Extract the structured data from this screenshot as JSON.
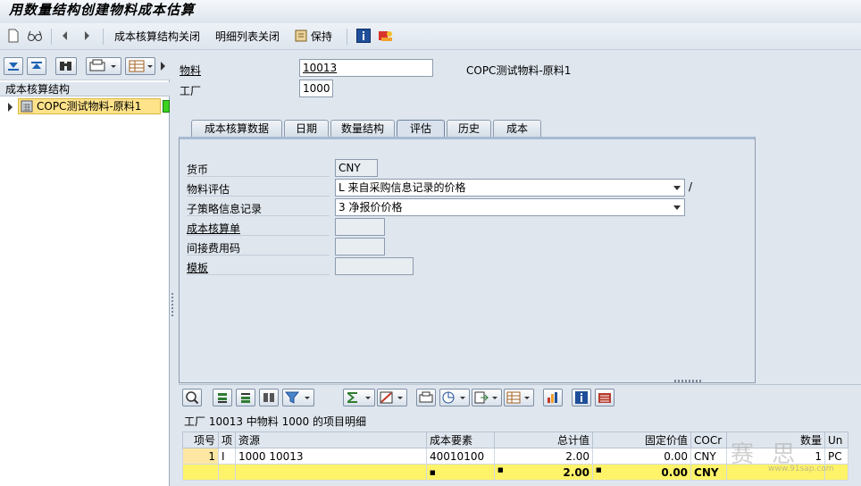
{
  "window": {
    "title": "用数量结构创建物料成本估算"
  },
  "toolbar": {
    "btn_structure": "成本核算结构关闭",
    "btn_list": "明细列表关闭",
    "btn_keep": "保持"
  },
  "tree": {
    "header": "成本核算结构",
    "node": "COPC测试物料-原料1"
  },
  "header": {
    "material_label": "物料",
    "material_value": "10013",
    "material_desc": "COPC测试物料-原料1",
    "plant_label": "工厂",
    "plant_value": "1000"
  },
  "tabs": [
    "成本核算数据",
    "日期",
    "数量结构",
    "评估",
    "历史",
    "成本"
  ],
  "valuation": {
    "currency_label": "货币",
    "currency_value": "CNY",
    "mat_val_label": "物料评估",
    "mat_val_value": "L 来自采购信息记录的价格",
    "mat_val_sep": "/",
    "sub_strategy_label": "子策略信息记录",
    "sub_strategy_value": "3 净报价价格",
    "cost_sheet_label": "成本核算单",
    "overhead_label": "间接费用码",
    "template_label": "模板"
  },
  "grid": {
    "title": "工厂 10013 中物料 1000 的项目明细",
    "columns": [
      "项号",
      "项",
      "资源",
      "成本要素",
      "总计值",
      "固定价值",
      "COCr",
      "数量",
      "Un"
    ],
    "rows": [
      {
        "item": "1",
        "cat": "I",
        "resource": "1000 10013",
        "cost_elem": "40010100",
        "total": "2.00",
        "fixed": "0.00",
        "cocr": "CNY",
        "qty": "1",
        "un": "PC"
      }
    ],
    "sum": {
      "mark": "■",
      "total": "2.00",
      "fixed": "0.00",
      "cocr": "CNY"
    }
  },
  "watermark": {
    "text": "赛 思",
    "url": "www.91sap.com"
  }
}
